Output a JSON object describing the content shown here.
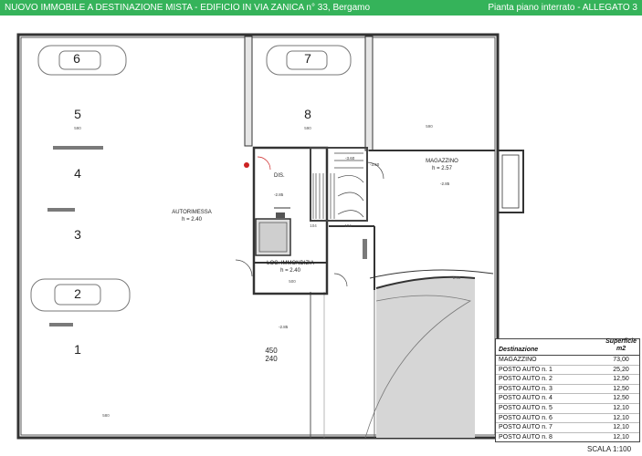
{
  "header": {
    "title": "NUOVO IMMOBILE A DESTINAZIONE MISTA - EDIFICIO IN VIA ZANICA n° 33, Bergamo",
    "subtitle": "Pianta piano interrato - ALLEGATO 3"
  },
  "plan": {
    "parking_numbers": [
      "6",
      "5",
      "4",
      "3",
      "2",
      "1",
      "7",
      "8"
    ],
    "rooms": {
      "autorimessa": {
        "name": "AUTORIMESSA",
        "height": "h = 2.40"
      },
      "magazzino": {
        "name": "MAGAZZINO",
        "height": "h = 2.57"
      },
      "dis": {
        "name": "DIS."
      },
      "locale_immondizia": {
        "name": "LOC. IMMONDIZIA",
        "height": "h = 2.40"
      }
    },
    "levels": [
      "-2.85",
      "-3.60",
      "-2.85",
      "-2.85",
      "-3.60"
    ],
    "dimensions": [
      "590",
      "500",
      "590",
      "590",
      "104",
      "104",
      "450",
      "240",
      "580",
      "1.50"
    ]
  },
  "legend": {
    "col_destinazione": "Destinazione",
    "col_superficie": "Superficie",
    "col_unit": "m2",
    "rows": [
      {
        "label": "MAGAZZINO",
        "value": "73,00"
      },
      {
        "label": "POSTO AUTO n. 1",
        "value": "25,20"
      },
      {
        "label": "POSTO AUTO n. 2",
        "value": "12,50"
      },
      {
        "label": "POSTO AUTO n. 3",
        "value": "12,50"
      },
      {
        "label": "POSTO AUTO n. 4",
        "value": "12,50"
      },
      {
        "label": "POSTO AUTO n. 5",
        "value": "12,10"
      },
      {
        "label": "POSTO AUTO n. 6",
        "value": "12,10"
      },
      {
        "label": "POSTO AUTO n. 7",
        "value": "12,10"
      },
      {
        "label": "POSTO AUTO n. 8",
        "value": "12,10"
      }
    ]
  },
  "scale": "SCALA 1:100"
}
